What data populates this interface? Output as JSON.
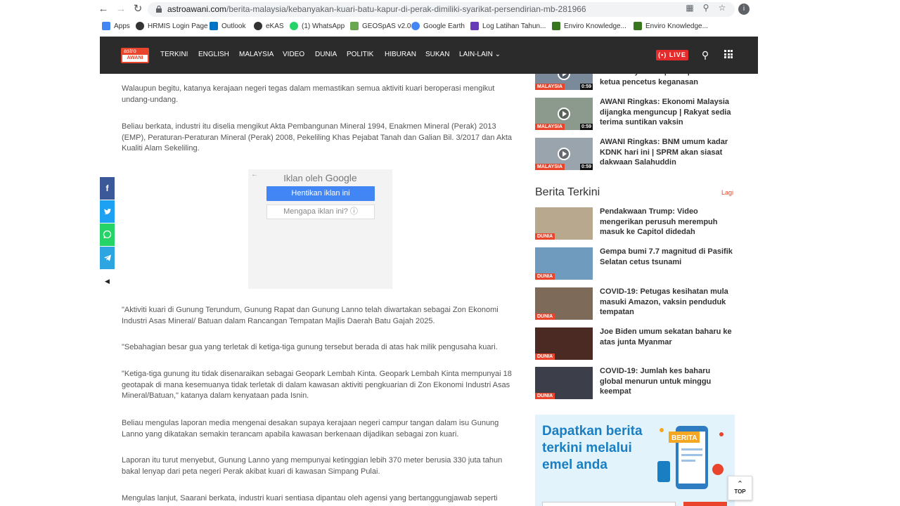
{
  "browser": {
    "url_domain": "astroawani.com",
    "url_path": "/berita-malaysia/kebanyakan-kuari-batu-kapur-di-perak-dimiliki-syarikat-persendirian-mb-281966",
    "profile_initial": "i"
  },
  "bookmarks": [
    {
      "label": "Apps",
      "color": "#4285f4"
    },
    {
      "label": "HRMIS Login Page",
      "color": "#333333"
    },
    {
      "label": "Outlook",
      "color": "#0072c6"
    },
    {
      "label": "eKAS",
      "color": "#333333"
    },
    {
      "label": "(1) WhatsApp",
      "color": "#25d366"
    },
    {
      "label": "GEOSpAS v2.0",
      "color": "#6aa84f"
    },
    {
      "label": "Google Earth",
      "color": "#4285f4"
    },
    {
      "label": "Log Latihan Tahun...",
      "color": "#673ab7"
    },
    {
      "label": "Enviro Knowledge...",
      "color": "#38761d"
    },
    {
      "label": "Enviro Knowledge...",
      "color": "#38761d"
    }
  ],
  "site": {
    "logo_top": "astro",
    "logo_bottom": "AWANI",
    "nav": [
      "TERKINI",
      "ENGLISH",
      "MALAYSIA",
      "VIDEO",
      "DUNIA",
      "POLITIK",
      "HIBURAN",
      "SUKAN",
      "LAIN-LAIN"
    ],
    "live_label": "LIVE",
    "brand_color": "#e8452c"
  },
  "article": {
    "paragraphs": [
      "Walaupun begitu, katanya kerajaan negeri tegas dalam memastikan semua aktiviti kuari beroperasi mengikut undang-undang.",
      "Beliau berkata, industri itu diselia mengikut Akta Pembangunan Mineral 1994, Enakmen Mineral (Perak) 2013 (EMP), Peraturan-Peraturan Mineral (Perak) 2008, Pekeliling Khas Pejabat Tanah dan Galian Bil. 3/2017 dan Akta Kualiti Alam Sekeliling.",
      "\"Aktiviti kuari di Gunung Terundum, Gunung Rapat dan Gunung Lanno telah diwartakan sebagai Zon Ekonomi Industri Asas Mineral/ Batuan dalam Rancangan Tempatan Majlis Daerah Batu Gajah 2025.",
      "\"Sebahagian besar gua yang terletak di ketiga-tiga gunung tersebut berada di atas hak milik pengusaha kuari.",
      "\"Ketiga-tiga gunung itu tidak disenaraikan sebagai Geopark Lembah Kinta. Geopark Lembah Kinta mempunyai 18 geotapak di mana kesemuanya tidak terletak di dalam kawasan aktiviti pengkuarian di Zon Ekonomi Industri Asas Mineral/Batuan,\" katanya dalam kenyataan pada Isnin.",
      "Beliau mengulas laporan media mengenai desakan supaya kerajaan negeri campur tangan dalam isu Gunung Lanno yang dikatakan semakin terancam apabila kawasan berkenaan dijadikan sebagai zon kuari.",
      "Laporan itu turut menyebut, Gunung Lanno yang mempunyai ketinggian lebih 370 meter berusia 330 juta tahun bakal lenyap dari peta negeri Perak akibat kuari di kawasan Simpang Pulai.",
      "Mengulas lanjut, Saarani berkata, industri kuari sentiasa dipantau oleh agensi yang bertanggungjawab seperti"
    ]
  },
  "ad": {
    "title_prefix": "Iklan oleh",
    "title_brand": "Google",
    "stop_label": "Hentikan iklan ini",
    "why_label": "Mengapa iklan ini?"
  },
  "share": [
    {
      "icon": "f",
      "color": "#3b5998"
    },
    {
      "icon": "t",
      "color": "#1da1f2"
    },
    {
      "icon": "w",
      "color": "#25d366"
    },
    {
      "icon": "telegram",
      "color": "#2ca5e0"
    }
  ],
  "sidebar": {
    "videos": [
      {
        "tag": "MALAYSIA",
        "duration": "0:59",
        "title": "ke atas Myanmar | Trump didakwa ketua pencetus keganasan",
        "thumb": "#7b8a9a"
      },
      {
        "tag": "MALAYSIA",
        "duration": "0:59",
        "title": "AWANI Ringkas: Ekonomi Malaysia dijangka menguncup | Rakyat sedia terima suntikan vaksin",
        "thumb": "#8c9a8e"
      },
      {
        "tag": "MALAYSIA",
        "duration": "0:59",
        "title": "AWANI Ringkas: BNM umum kadar KDNK hari ini | SPRM akan siasat dakwaan Salahuddin",
        "thumb": "#9aa4ad"
      }
    ],
    "section_title": "Berita Terkini",
    "section_more": "Lagi",
    "latest": [
      {
        "tag": "DUNIA",
        "title": "Pendakwaan Trump: Video mengerikan perusuh merempuh masuk ke Capitol didedah",
        "thumb": "#b8a88e"
      },
      {
        "tag": "DUNIA",
        "title": "Gempa bumi 7.7 magnitud di Pasifik Selatan cetus tsunami",
        "thumb": "#6f9bbf"
      },
      {
        "tag": "DUNIA",
        "title": "COVID-19: Petugas kesihatan mula masuki Amazon, vaksin penduduk tempatan",
        "thumb": "#7d6a58"
      },
      {
        "tag": "DUNIA",
        "title": "Joe Biden umum sekatan baharu ke atas junta Myanmar",
        "thumb": "#4a2a22"
      },
      {
        "tag": "DUNIA",
        "title": "COVID-19: Jumlah kes baharu global menurun untuk minggu keempat",
        "thumb": "#3c3f4a"
      }
    ],
    "promo_text": "Dapatkan berita terkini melalui emel anda",
    "promo_badge": "BERITA"
  },
  "top_button": "TOP"
}
